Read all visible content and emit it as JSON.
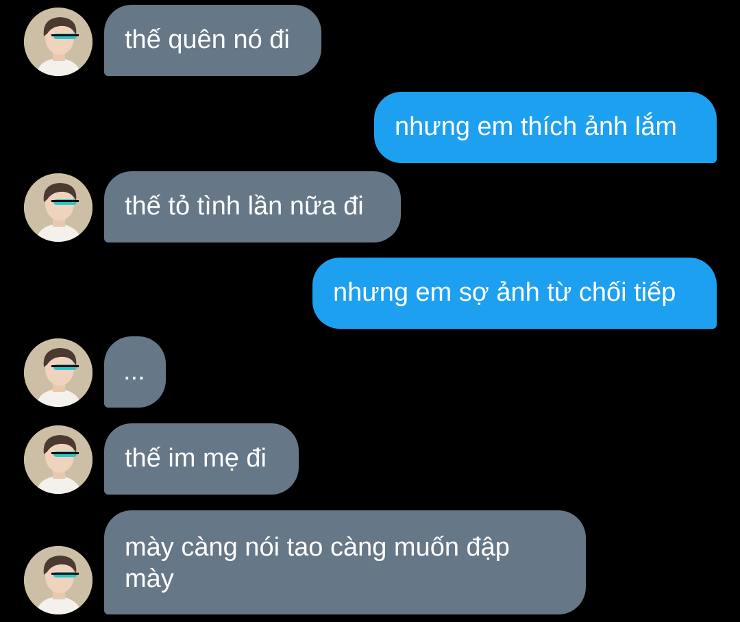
{
  "colors": {
    "background": "#000000",
    "received_bubble": "#667788",
    "sent_bubble": "#1ea0f0",
    "text": "#ffffff"
  },
  "messages": [
    {
      "direction": "received",
      "text": "thế quên nó đi"
    },
    {
      "direction": "sent",
      "text": "nhưng em thích ảnh lắm"
    },
    {
      "direction": "received",
      "text": "thế tỏ tình lần nữa đi"
    },
    {
      "direction": "sent",
      "text": "nhưng em sợ ảnh từ chối tiếp"
    },
    {
      "direction": "received",
      "text": "..."
    },
    {
      "direction": "received",
      "text": "thế im mẹ đi"
    },
    {
      "direction": "received",
      "text": "mày càng nói tao càng muốn đập mày"
    }
  ]
}
